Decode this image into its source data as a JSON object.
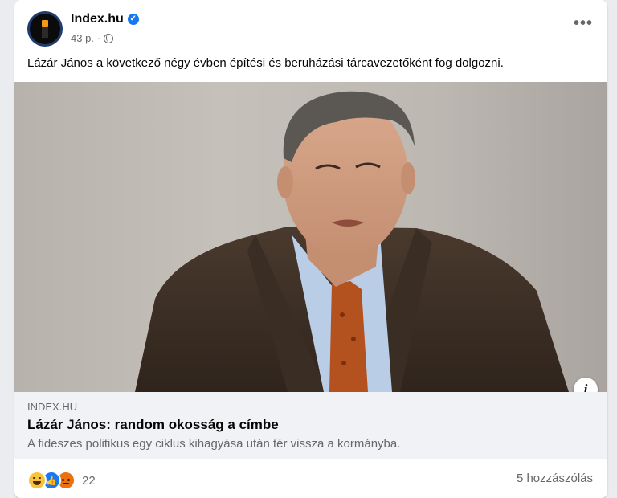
{
  "post": {
    "page_name": "Index.hu",
    "timestamp": "43 p.",
    "visibility_icon": "globe-icon",
    "text": "Lázár János a következő négy évben építési és beruházási tárcavezetőként fog dolgozni."
  },
  "link_preview": {
    "domain": "INDEX.HU",
    "title": "Lázár János: random okosság a címbe",
    "description": "A fideszes politikus egy ciklus kihagyása után tér vissza a kormányba."
  },
  "reactions": {
    "icons": [
      "haha-reaction-icon",
      "like-reaction-icon",
      "angry-reaction-icon"
    ],
    "count": "22",
    "comments": "5 hozzászólás"
  },
  "colors": {
    "accent": "#1877f2",
    "link_box_bg": "#f0f2f5",
    "secondary_text": "#65676b"
  }
}
